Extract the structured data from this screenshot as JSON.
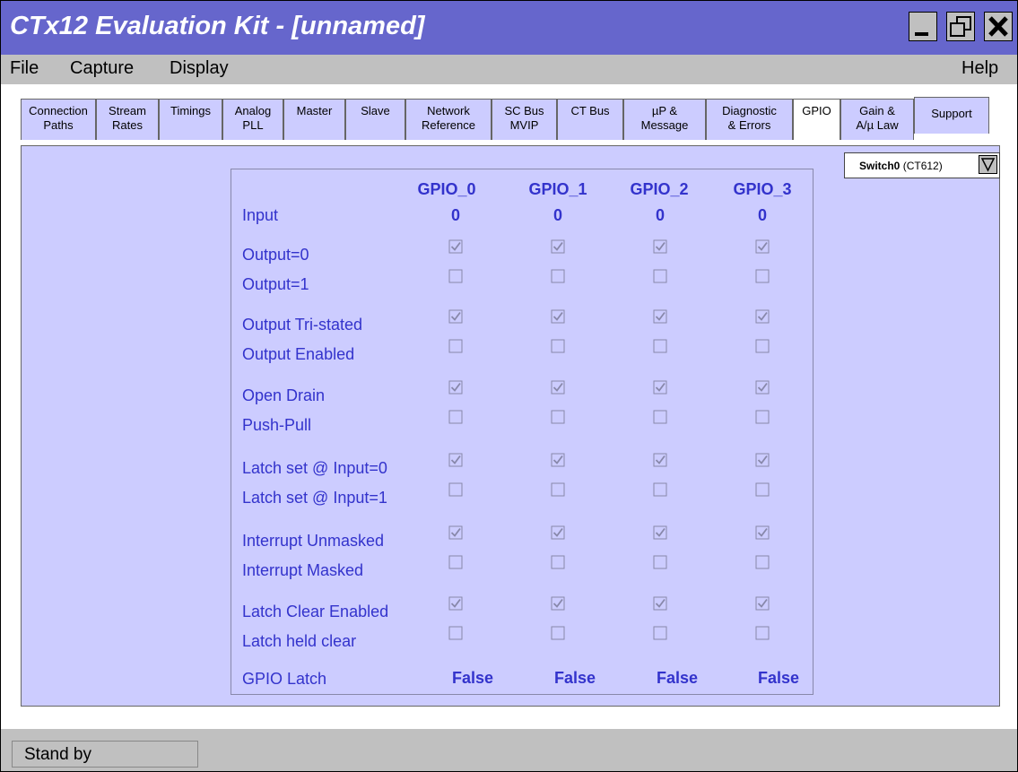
{
  "window": {
    "title": "CTx12 Evaluation Kit - [unnamed]"
  },
  "menu": {
    "file": "File",
    "capture": "Capture",
    "display": "Display",
    "help": "Help"
  },
  "tabs": [
    {
      "label": "Connection\nPaths"
    },
    {
      "label": "Stream\nRates"
    },
    {
      "label": "Timings"
    },
    {
      "label": "Analog\nPLL"
    },
    {
      "label": "Master"
    },
    {
      "label": "Slave"
    },
    {
      "label": "Network\nReference"
    },
    {
      "label": "SC Bus\nMVIP"
    },
    {
      "label": "CT Bus"
    },
    {
      "label": "µP &\nMessage"
    },
    {
      "label": "Diagnostic\n& Errors"
    },
    {
      "label": "GPIO",
      "active": true
    },
    {
      "label": "Gain &\nA/µ Law"
    },
    {
      "label": "Support"
    }
  ],
  "switch_select": {
    "name": "Switch0",
    "model": "(CT612)"
  },
  "gpio": {
    "columns": [
      "GPIO_0",
      "GPIO_1",
      "GPIO_2",
      "GPIO_3"
    ],
    "input_label": "Input",
    "input_values": [
      "0",
      "0",
      "0",
      "0"
    ],
    "rows": [
      {
        "label": "Output=0",
        "checked": true
      },
      {
        "label": "Output=1",
        "checked": false
      },
      {
        "label": "Output Tri-stated",
        "checked": true
      },
      {
        "label": "Output Enabled",
        "checked": false
      },
      {
        "label": "Open Drain",
        "checked": true
      },
      {
        "label": "Push-Pull",
        "checked": false
      },
      {
        "label": "Latch set @ Input=0",
        "checked": true
      },
      {
        "label": "Latch set @ Input=1",
        "checked": false
      },
      {
        "label": "Interrupt Unmasked",
        "checked": true
      },
      {
        "label": "Interrupt Masked",
        "checked": false
      },
      {
        "label": "Latch Clear Enabled",
        "checked": true
      },
      {
        "label": "Latch held clear",
        "checked": false
      }
    ],
    "latch_label": "GPIO Latch",
    "latch_values": [
      "False",
      "False",
      "False",
      "False"
    ]
  },
  "status": {
    "text": "Stand by"
  },
  "colors": {
    "title_bar": "#6666cc",
    "panel": "#ccccff",
    "accent_text": "#3333cc",
    "chrome": "#c0c0c0"
  }
}
